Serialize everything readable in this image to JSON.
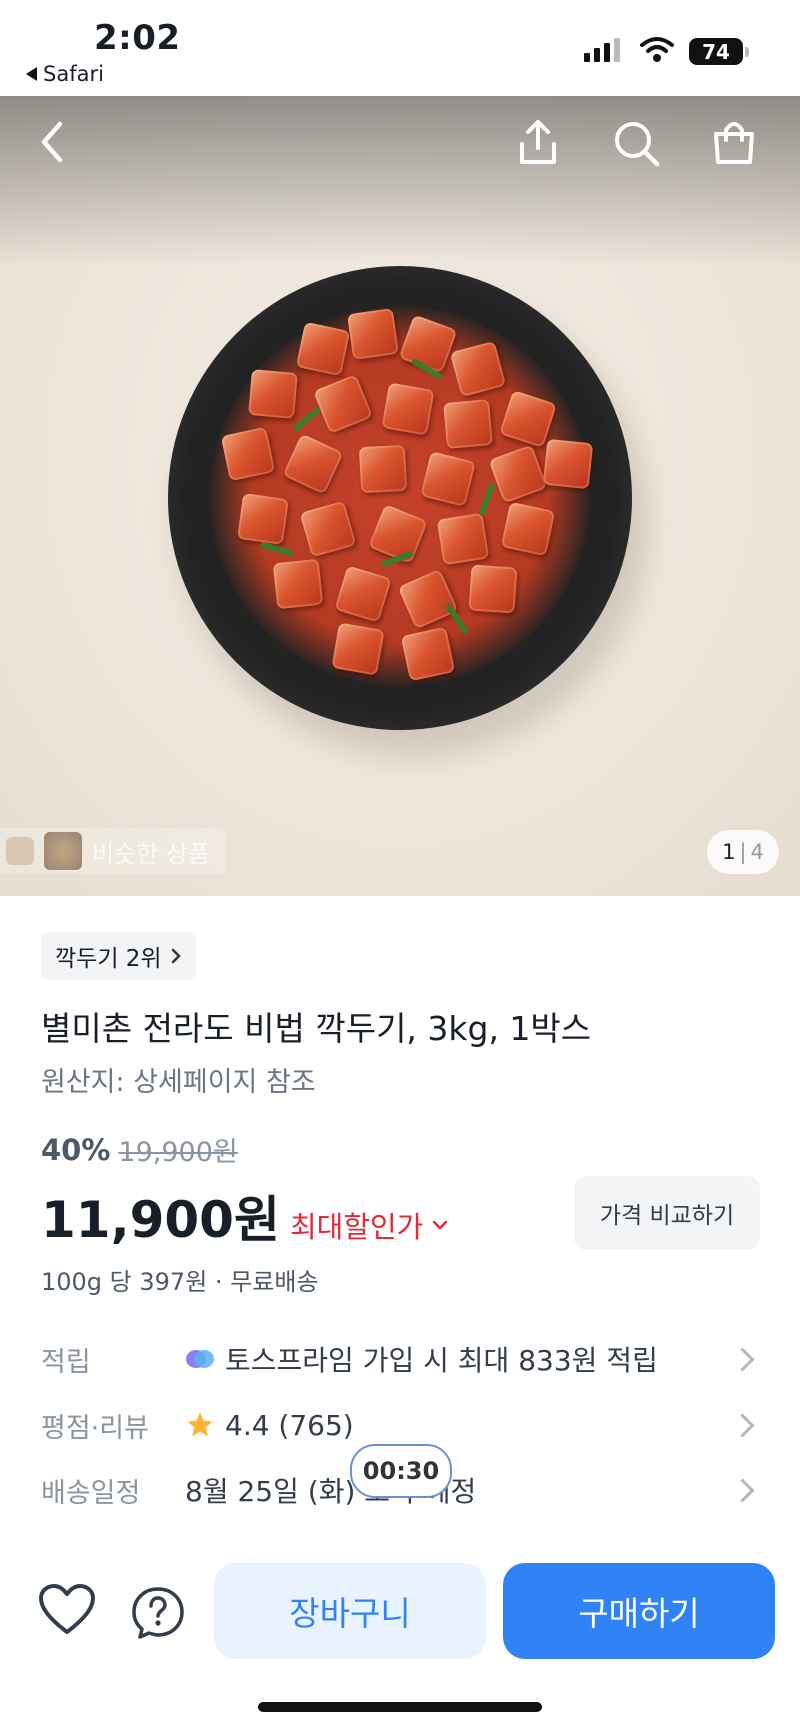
{
  "status_bar": {
    "time": "2:02",
    "back_app": "Safari",
    "battery": "74"
  },
  "header_icons": [
    "back-icon",
    "share-icon",
    "search-icon",
    "shopping-bag-icon"
  ],
  "gallery": {
    "similar_label": "비슷한 상품",
    "counter_current": "1",
    "counter_separator": "|",
    "counter_total": "4"
  },
  "product": {
    "rank_badge": "깍두기 2위",
    "title": "별미촌 전라도 비법 깍두기, 3kg, 1박스",
    "origin": "원산지: 상세페이지 참조",
    "discount_percent": "40%",
    "original_price": "19,900원",
    "price": "11,900원",
    "max_discount_label": "최대할인가",
    "compare_button": "가격 비교하기",
    "unit_price": "100g 당 397원 · 무료배송"
  },
  "info_rows": {
    "points": {
      "label": "적립",
      "value": "토스프라임 가입 시 최대 833원 적립"
    },
    "rating": {
      "label": "평점·리뷰",
      "value": "4.4 (765)"
    },
    "delivery": {
      "label": "배송일정",
      "value": "8월 25일 (화) 도착 예정"
    }
  },
  "timer": "00:30",
  "bottom_bar": {
    "cart_button": "장바구니",
    "buy_button": "구매하기"
  },
  "colors": {
    "primary": "#3182f6",
    "primary_light": "#e8f3ff",
    "discount_red": "#e42939",
    "star": "#ffb331"
  }
}
